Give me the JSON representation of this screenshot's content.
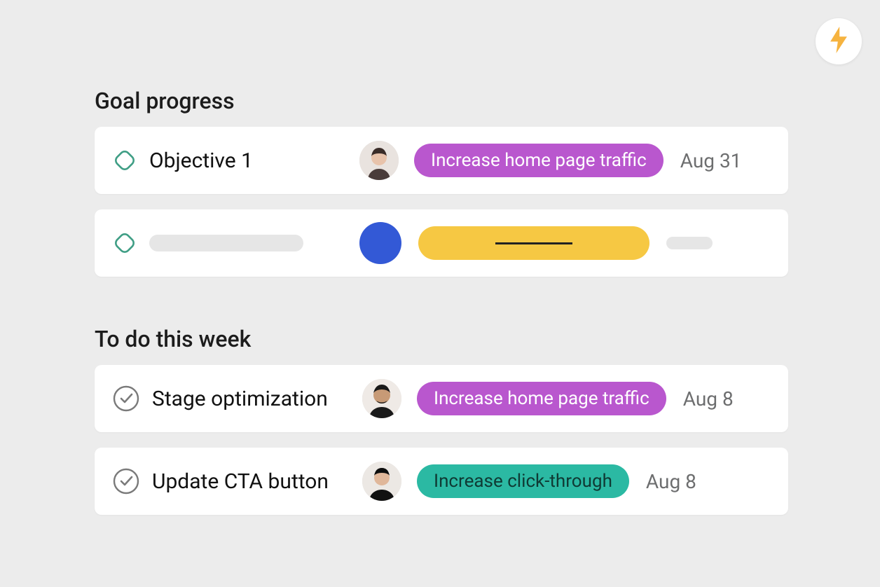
{
  "colors": {
    "purple": "#b957ce",
    "teal": "#2bb9a3",
    "yellow": "#f6c843",
    "blue": "#3359d6",
    "goalStroke": "#3f9e85"
  },
  "lightning": {
    "name": "lightning-icon"
  },
  "sections": {
    "goals": {
      "title": "Goal progress",
      "items": [
        {
          "title": "Objective 1",
          "tag": {
            "label": "Increase home page traffic",
            "colorKey": "purple"
          },
          "date": "Aug 31"
        }
      ]
    },
    "todo": {
      "title": "To do this week",
      "items": [
        {
          "title": "Stage optimization",
          "tag": {
            "label": "Increase home page traffic",
            "colorKey": "purple"
          },
          "date": "Aug 8"
        },
        {
          "title": "Update CTA button",
          "tag": {
            "label": "Increase click-through",
            "colorKey": "teal"
          },
          "date": "Aug 8"
        }
      ]
    }
  }
}
